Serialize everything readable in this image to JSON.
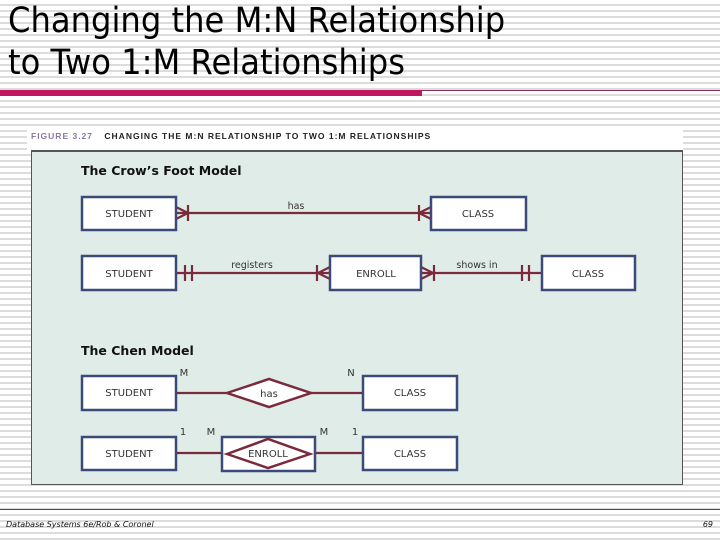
{
  "slide": {
    "title_line1": "Changing the M:N Relationship",
    "title_line2": "to Two 1:M Relationships",
    "accent_color": "#c0155f"
  },
  "figure": {
    "number": "FIGURE 3.27",
    "title": "CHANGING THE M:N RELATIONSHIP TO TWO 1:M RELATIONSHIPS",
    "panel_color": "#e0ece8",
    "crows_foot": {
      "section_title": "The Crow’s Foot Model",
      "row1": {
        "left_entity": "STUDENT",
        "relationship": "has",
        "right_entity": "CLASS",
        "left_symbol": "many-optional-one",
        "right_symbol": "many-optional-one"
      },
      "row2": {
        "left_entity": "STUDENT",
        "relationship1": "registers",
        "middle_entity": "ENROLL",
        "relationship2": "shows in",
        "right_entity": "CLASS"
      }
    },
    "chen": {
      "section_title": "The Chen Model",
      "row1": {
        "left_entity": "STUDENT",
        "left_cardinality": "M",
        "relationship": "has",
        "right_cardinality": "N",
        "right_entity": "CLASS"
      },
      "row2": {
        "left_entity": "STUDENT",
        "card_a": "1",
        "card_b": "M",
        "associative_entity": "ENROLL",
        "card_c": "M",
        "card_d": "1",
        "right_entity": "CLASS"
      }
    }
  },
  "footer": {
    "source": "Database Systems 6e/Rob & Coronel",
    "page_number": "69"
  }
}
